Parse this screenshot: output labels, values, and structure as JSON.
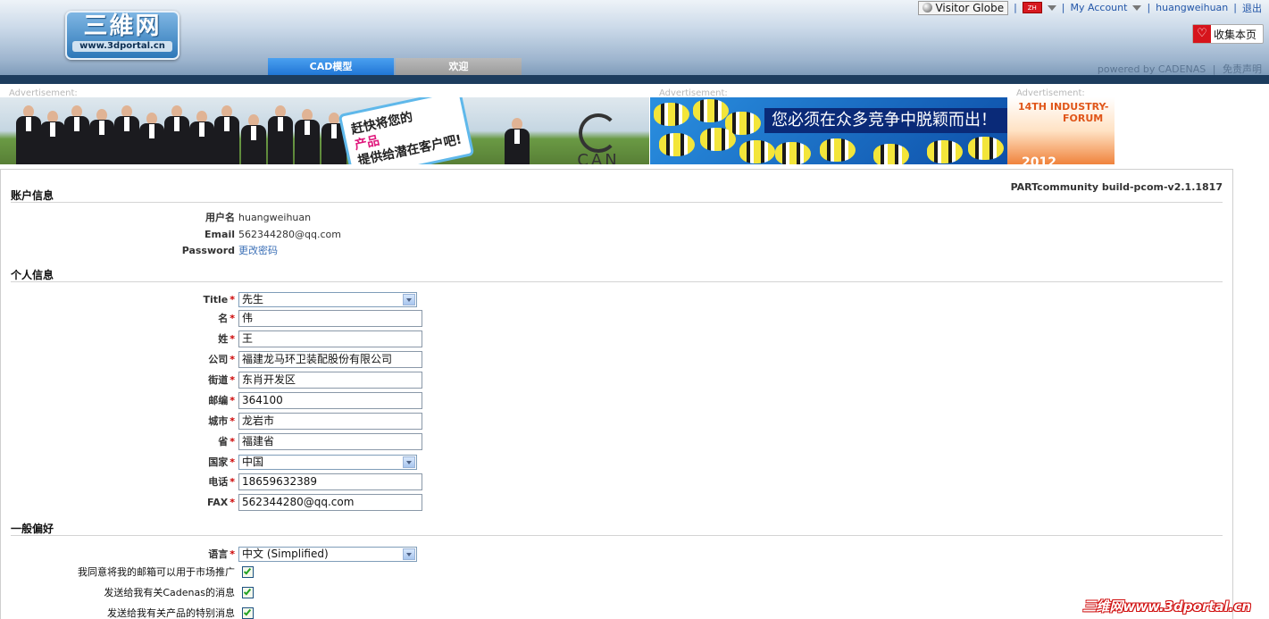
{
  "header": {
    "logo_text": "三維网",
    "logo_url": "www.3dportal.cn",
    "visitor_globe": "Visitor Globe",
    "lang_flag": "ZH",
    "my_account": "My Account",
    "username": "huangweihuan",
    "logout": "退出",
    "bookmark": "收集本页",
    "powered_by": "powered by CADENAS",
    "disclaimer": "免责声明",
    "tabs": [
      {
        "label": "CAD模型",
        "active": true
      },
      {
        "label": "欢迎",
        "active": false
      }
    ]
  },
  "ads": {
    "label": "Advertisement:",
    "banner1_line1": "赶快将您的",
    "banner1_line2": "产品",
    "banner1_line3": "提供给潜在客户吧!",
    "banner1_logo": "CAN",
    "banner2_text": "您必须在众多竞争中脱颖而出！",
    "banner3_line1": "14TH INDUSTRY-",
    "banner3_line2": "FORUM",
    "banner3_year": "2012"
  },
  "build": "PARTcommunity build-pcom-v2.1.1817",
  "account": {
    "title": "账户信息",
    "username_label": "用户名",
    "username_value": "huangweihuan",
    "email_label": "Email",
    "email_value": "562344280@qq.com",
    "password_label": "Password",
    "password_link": "更改密码"
  },
  "personal": {
    "title": "个人信息",
    "required_mark": "*",
    "fields": [
      {
        "label": "Title",
        "value": "先生",
        "type": "select"
      },
      {
        "label": "名",
        "value": "伟",
        "type": "input"
      },
      {
        "label": "姓",
        "value": "王",
        "type": "input"
      },
      {
        "label": "公司",
        "value": "福建龙马环卫装配股份有限公司",
        "type": "input"
      },
      {
        "label": "街道",
        "value": "东肖开发区",
        "type": "input"
      },
      {
        "label": "邮编",
        "value": "364100",
        "type": "input"
      },
      {
        "label": "城市",
        "value": "龙岩市",
        "type": "input"
      },
      {
        "label": "省",
        "value": "福建省",
        "type": "input"
      },
      {
        "label": "国家",
        "value": "中国",
        "type": "select"
      },
      {
        "label": "电话",
        "value": "18659632389",
        "type": "input"
      },
      {
        "label": "FAX",
        "value": "562344280@qq.com",
        "type": "input"
      }
    ]
  },
  "preferences": {
    "title": "一般偏好",
    "language_label": "语言",
    "language_value": "中文 (Simplified)",
    "checkboxes": [
      {
        "label": "我同意将我的邮箱可以用于市场推广",
        "checked": true
      },
      {
        "label": "发送给我有关Cadenas的消息",
        "checked": true
      },
      {
        "label": "发送给我有关产品的特别消息",
        "checked": true
      }
    ]
  },
  "watermark": "三维网www.3dportal.cn"
}
